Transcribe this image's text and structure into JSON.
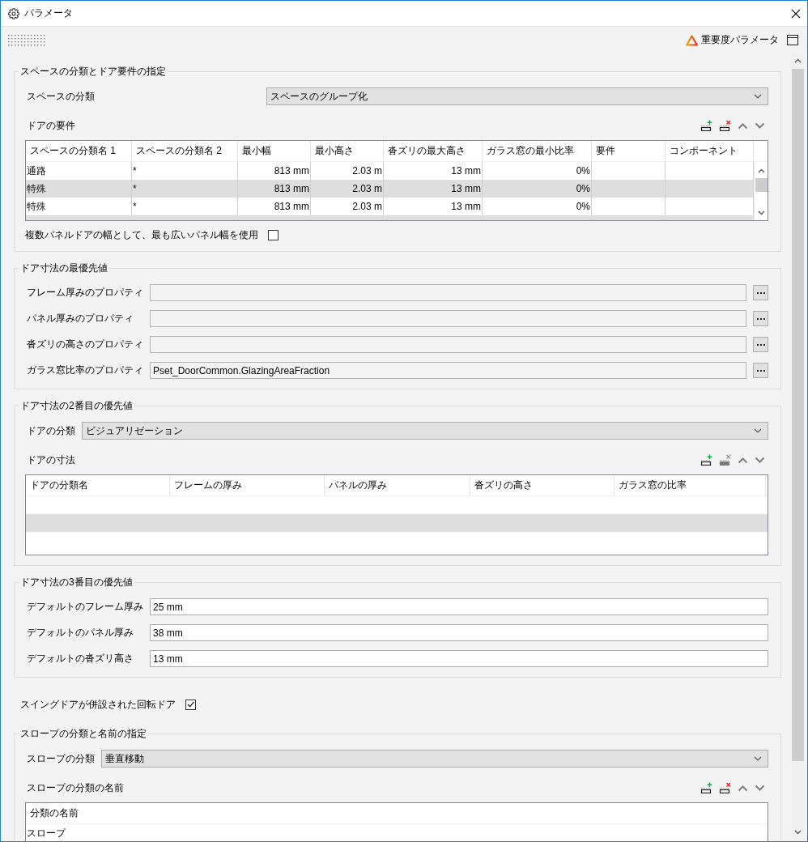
{
  "window": {
    "title": "パラメータ"
  },
  "toolbar": {
    "importance_button": "重要度パラメータ"
  },
  "content": [
    {
      "kind": "group",
      "legend": "スペースの分類とドア要件の指定",
      "items": [
        {
          "kind": "split_combo",
          "label": "スペースの分類",
          "value": "スペースのグループ化"
        },
        {
          "kind": "table",
          "label": "ドアの要件",
          "tools": [
            {
              "kind": "add",
              "disabled": false
            },
            {
              "kind": "delete",
              "disabled": false
            },
            {
              "kind": "up",
              "disabled": false
            },
            {
              "kind": "down",
              "disabled": false
            }
          ],
          "scrollbar": true,
          "columns": [
            {
              "title": "スペースの分類名 1",
              "kind": "text"
            },
            {
              "title": "スペースの分類名 2",
              "kind": "text"
            },
            {
              "title": "最小幅",
              "kind": "number"
            },
            {
              "title": "最小高さ",
              "kind": "number"
            },
            {
              "title": "沓ズリの最大高さ",
              "kind": "number"
            },
            {
              "title": "ガラス窓の最小比率",
              "kind": "number"
            },
            {
              "title": "要件"
            },
            {
              "title": "コンポーネント"
            }
          ],
          "rows": [
            [
              "通路",
              "*",
              "813 mm",
              "2.03 m",
              "13 mm",
              "0%"
            ],
            [
              "特殊",
              "*",
              "813 mm",
              "2.03 m",
              "13 mm",
              "0%"
            ],
            [
              "特殊",
              "*",
              "813 mm",
              "2.03 m",
              "13 mm",
              "0%"
            ]
          ]
        },
        {
          "kind": "checkbox",
          "label": "複数パネルドアの幅として、最も広いパネル幅を使用",
          "checked": false
        }
      ]
    },
    {
      "kind": "group",
      "legend": "ドア寸法の最優先値",
      "items": [
        {
          "kind": "property",
          "label": "フレーム厚みのプロパティ"
        },
        {
          "kind": "property",
          "label": "パネル厚みのプロパティ"
        },
        {
          "kind": "property",
          "label": "沓ズリの高さのプロパティ"
        },
        {
          "kind": "property",
          "label": "ガラス窓比率のプロパティ",
          "value": "Pset_DoorCommon.GlazingAreaFraction"
        }
      ]
    },
    {
      "kind": "group",
      "legend": "ドア寸法の2番目の優先値",
      "items": [
        {
          "kind": "inline_combo",
          "label": "ドアの分類",
          "value": "ビジュアリゼーション"
        },
        {
          "kind": "table",
          "label": "ドアの寸法",
          "tools": [
            {
              "kind": "add",
              "disabled": false
            },
            {
              "kind": "delete",
              "disabled": true
            },
            {
              "kind": "up",
              "disabled": false
            },
            {
              "kind": "down",
              "disabled": false
            }
          ],
          "columns": [
            {
              "title": "ドアの分類名"
            },
            {
              "title": "フレームの厚み"
            },
            {
              "title": "パネルの厚み"
            },
            {
              "title": "沓ズリの高さ"
            },
            {
              "title": "ガラス窓の比率"
            }
          ]
        }
      ]
    },
    {
      "kind": "group",
      "legend": "ドア寸法の3番目の優先値",
      "items": [
        {
          "kind": "field",
          "label": "デフォルトのフレーム厚み",
          "value": "25 mm"
        },
        {
          "kind": "field",
          "label": "デフォルトのパネル厚み",
          "value": "38 mm"
        },
        {
          "kind": "field",
          "label": "デフォルトの沓ズリ高さ",
          "value": "13 mm"
        }
      ]
    },
    {
      "kind": "checkbox",
      "label": "スイングドアが併設された回転ドア",
      "checked": true
    },
    {
      "kind": "group",
      "legend": "スロープの分類と名前の指定",
      "items": [
        {
          "kind": "inline_combo",
          "label": "スロープの分類",
          "value": "垂直移動"
        },
        {
          "kind": "table",
          "label": "スロープの分類の名前",
          "tools": [
            {
              "kind": "add",
              "disabled": false
            },
            {
              "kind": "delete",
              "disabled": false
            },
            {
              "kind": "up",
              "disabled": false
            },
            {
              "kind": "down",
              "disabled": false
            }
          ],
          "columns": [
            {
              "title": "分類の名前"
            }
          ],
          "rows": [
            [
              "スロープ"
            ]
          ]
        }
      ]
    }
  ]
}
